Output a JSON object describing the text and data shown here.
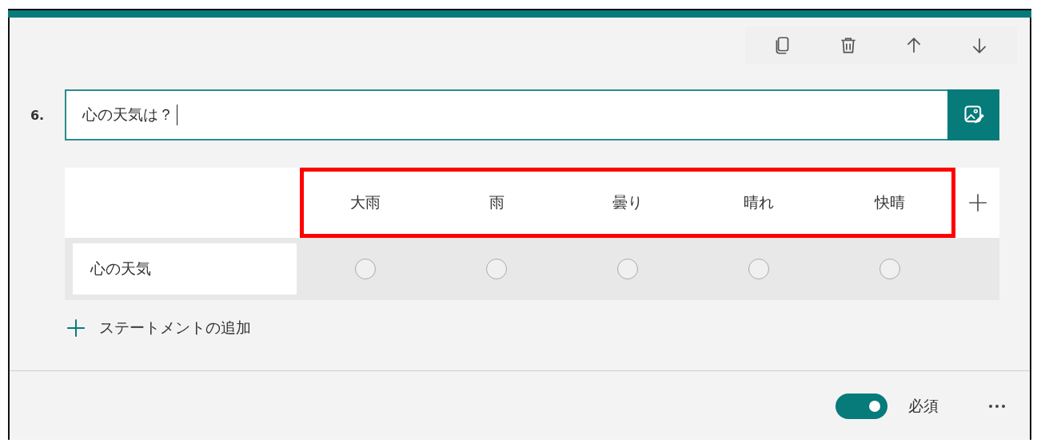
{
  "toolbar": {
    "buttons": [
      {
        "kind": "copy"
      },
      {
        "kind": "delete"
      },
      {
        "kind": "up"
      },
      {
        "kind": "down"
      }
    ]
  },
  "question": {
    "number": "6.",
    "value": "心の天気は？",
    "focused": true
  },
  "grid": {
    "columns": [
      {
        "label": "大雨"
      },
      {
        "label": "雨"
      },
      {
        "label": "曇り"
      },
      {
        "label": "晴れ"
      },
      {
        "label": "快晴"
      }
    ],
    "highlighted": true,
    "rows": [
      {
        "label": "心の天気",
        "choices": [
          {
            "selected": false
          },
          {
            "selected": false
          },
          {
            "selected": false
          },
          {
            "selected": false
          },
          {
            "selected": false
          }
        ]
      }
    ]
  },
  "add_statement": "ステートメントの追加",
  "footer": {
    "required": {
      "label": "必須",
      "on": true
    }
  }
}
